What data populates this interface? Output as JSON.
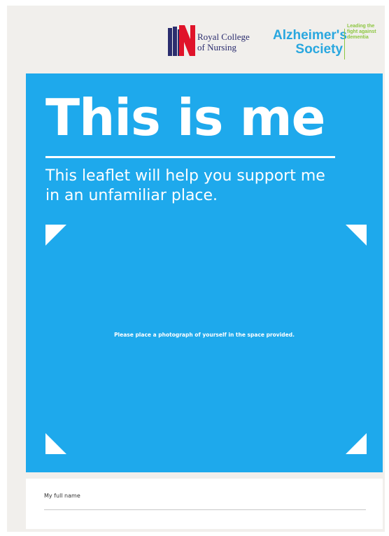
{
  "logos": {
    "rcn": {
      "name_lines": [
        "Royal College",
        "of Nursing"
      ],
      "colors": {
        "red": "#e0142a",
        "blue": "#2b2d6e"
      }
    },
    "alzheimers": {
      "name_lines": [
        "Alzheimer's",
        "Society"
      ],
      "tagline_lines": [
        "Leading the",
        "fight against",
        "dementia"
      ],
      "colors": {
        "name": "#29a7df",
        "tagline": "#8cc63f"
      }
    }
  },
  "leaflet": {
    "title": "This is me",
    "subtitle_lines": [
      "This leaflet will help you support me",
      "in an unfamiliar place."
    ],
    "photo_caption": "Please place a photograph of yourself in the space provided.",
    "name_field_label": "My full name",
    "colors": {
      "panel": "#1ea9ec",
      "text": "#ffffff"
    }
  }
}
